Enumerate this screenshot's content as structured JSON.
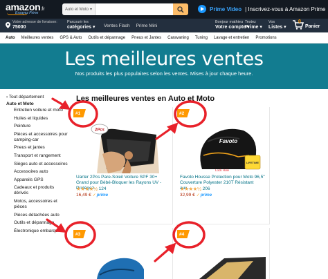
{
  "header": {
    "logo_word": "amazon",
    "logo_tld": ".fr",
    "logo_tagline": "Essayez Prime",
    "search_category": "Auto et Moto",
    "search_value": "",
    "prime_video_brand": "Prime Video",
    "prime_video_text": "| Inscrivez-vous à Amazon Prime"
  },
  "subnav": {
    "deliver_line1": "Votre adresse de livraison:",
    "deliver_line2": "75000",
    "browse_line1": "Parcourir les",
    "browse_line2": "catégories ▾",
    "links": [
      "Ventes Flash",
      "Prime Mini"
    ],
    "account_line1": "Bonjour mathieu",
    "account_line2": "Votre compte ▾",
    "prime_line1": "Testez",
    "prime_line2": "Prime ▾",
    "lists_line1": "Vos",
    "lists_line2": "Listes ▾",
    "cart_count": "0",
    "cart_label": "Panier"
  },
  "category_bar": [
    "Auto",
    "Meilleures ventes",
    "GPS & Auto",
    "Outils et dépannage",
    "Pneus et Jantes",
    "Caravaning",
    "Tuning",
    "Lavage et entretien",
    "Promotions"
  ],
  "hero": {
    "title": "Les meilleures ventes",
    "subtitle": "Nos produits les plus populaires selon les ventes. Mises à jour chaque heure."
  },
  "sidebar": {
    "back": "‹ Tout département",
    "current": "Auto et Moto",
    "items": [
      "Entretien voiture et moto",
      "Huiles et liquides",
      "Peinture",
      "Pièces et accessoires pour camping-car",
      "Pneus et jantes",
      "Transport et rangement",
      "Sièges auto et accessoires",
      "Accessoires auto",
      "Appareils GPS",
      "Cadeaux et produits dérivés",
      "Motos, accessoires et pièces",
      "Pièces détachées auto",
      "Outils et dépannage",
      "Électronique embarquée"
    ]
  },
  "main": {
    "title": "Les meilleures ventes en Auto et Moto",
    "products": [
      {
        "rank": "#1",
        "title": "Uarter 2Pcs Pare-Soleil Voiture SPF 30+ Grand pour Bébé-Bloquer les Rayons UV - Protégez...",
        "stars": "★★★★½",
        "reviews": "124",
        "price": "16,49 €",
        "prime": "prime",
        "image_label": "2Pcs"
      },
      {
        "rank": "#2",
        "title": "Favoto Housse Protection pour Moto 96,5\" Couverture Polyester 210T Résistant aux...",
        "stars": "★★★★½",
        "reviews": "206",
        "price": "32,99 €",
        "prime": "prime",
        "image_label": "Favoto",
        "badge": "LIFETIME",
        "lock_label": "Lock Hole"
      },
      {
        "rank": "#3"
      },
      {
        "rank": "#4"
      }
    ]
  },
  "colors": {
    "nav_dark": "#131921",
    "nav_secondary": "#232f3e",
    "hero": "#127c90",
    "rank_badge": "#ff9900",
    "annotation_red": "#e8212a",
    "link": "#007185",
    "price": "#b12704"
  }
}
